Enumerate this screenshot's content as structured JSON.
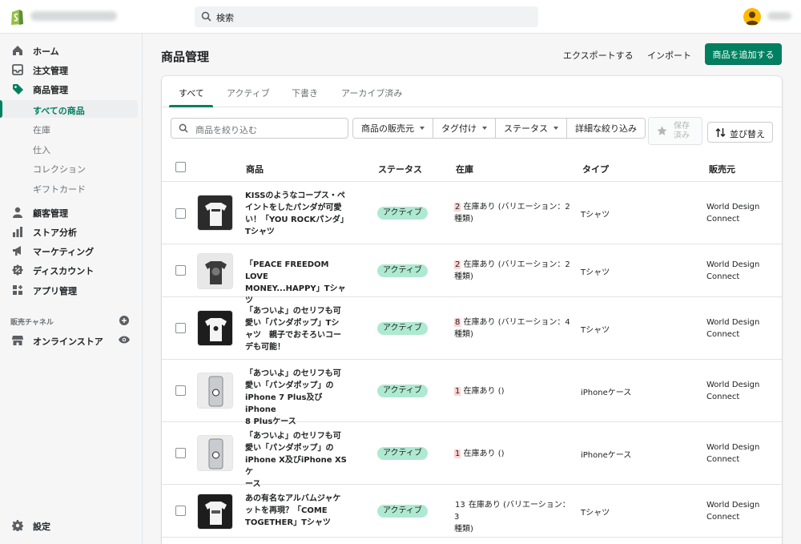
{
  "search": {
    "placeholder": "検索"
  },
  "sidebar": {
    "items": [
      {
        "label": "ホーム",
        "icon": "home-icon"
      },
      {
        "label": "注文管理",
        "icon": "orders-icon"
      },
      {
        "label": "商品管理",
        "icon": "tag-icon"
      }
    ],
    "sub_items": [
      "すべての商品",
      "在庫",
      "仕入",
      "コレクション",
      "ギフトカード"
    ],
    "items2": [
      {
        "label": "顧客管理",
        "icon": "customer-icon"
      },
      {
        "label": "ストア分析",
        "icon": "analytics-icon"
      },
      {
        "label": "マーケティング",
        "icon": "marketing-icon"
      },
      {
        "label": "ディスカウント",
        "icon": "discount-icon"
      },
      {
        "label": "アプリ管理",
        "icon": "apps-icon"
      }
    ],
    "channels_heading": "販売チャネル",
    "online_store": "オンラインストア",
    "settings": "設定"
  },
  "header": {
    "title": "商品管理",
    "export": "エクスポートする",
    "import": "インポート",
    "add_product": "商品を追加する"
  },
  "tabs": [
    "すべて",
    "アクティブ",
    "下書き",
    "アーカイブ済み"
  ],
  "filters": {
    "placeholder": "商品を絞り込む",
    "vendor": "商品の販売元",
    "tagged": "タグ付け",
    "status": "ステータス",
    "more": "詳細な絞り込み",
    "save_line1": "保存",
    "save_line2": "済み",
    "sort": "並び替え"
  },
  "table": {
    "headers": {
      "product": "商品",
      "status": "ステータス",
      "inventory": "在庫",
      "type": "タイプ",
      "vendor": "販売元"
    },
    "rows": [
      {
        "name_l1": "KISSのようなコープス・ペ",
        "name_l2": "イントをしたパンダが可愛",
        "name_l3": "い！「YOU ROCKパンダ」",
        "name_l4": "Tシャツ",
        "status": "アクティブ",
        "stock_num": "2",
        "stock_l1": " 在庫あり (バリエーション：2",
        "stock_l2": "種類)",
        "type": "Tシャツ",
        "vendor_l1": "World Design",
        "vendor_l2": "Connect"
      },
      {
        "name_l1": "「PEACE FREEDOM LOVE",
        "name_l2": "MONEY...HAPPY」Tシャツ",
        "status": "アクティブ",
        "stock_num": "2",
        "stock_l1": " 在庫あり (バリエーション：2",
        "stock_l2": "種類)",
        "type": "Tシャツ",
        "vendor_l1": "World Design",
        "vendor_l2": "Connect"
      },
      {
        "name_l1": "「あついよ」のセリフも可",
        "name_l2": "愛い「パンダポップ」Tシ",
        "name_l3": "ャツ　親子でおそろいコー",
        "name_l4": "デも可能！",
        "status": "アクティブ",
        "stock_num": "8",
        "stock_l1": " 在庫あり (バリエーション：4",
        "stock_l2": "種類)",
        "type": "Tシャツ",
        "vendor_l1": "World Design",
        "vendor_l2": "Connect"
      },
      {
        "name_l1": "「あついよ」のセリフも可",
        "name_l2": "愛い「パンダポップ」の",
        "name_l3": "iPhone 7 Plus及び iPhone",
        "name_l4": "8 Plusケース",
        "status": "アクティブ",
        "stock_num": "1",
        "stock_l1": " 在庫あり ()",
        "type": "iPhoneケース",
        "vendor_l1": "World Design",
        "vendor_l2": "Connect"
      },
      {
        "name_l1": "「あついよ」のセリフも可",
        "name_l2": "愛い「パンダポップ」の",
        "name_l3": "iPhone X及びiPhone XS ケ",
        "name_l4": "ース",
        "status": "アクティブ",
        "stock_num": "1",
        "stock_l1": " 在庫あり ()",
        "type": "iPhoneケース",
        "vendor_l1": "World Design",
        "vendor_l2": "Connect"
      },
      {
        "name_l1": "あの有名なアルバムジャケ",
        "name_l2": "ットを再現？「COME",
        "name_l3": "TOGETHER」Tシャツ",
        "status": "アクティブ",
        "stock_num": "13",
        "stock_l1": " 在庫あり (バリエーション：3",
        "stock_l2": "種類)",
        "type": "Tシャツ",
        "vendor_l1": "World Design",
        "vendor_l2": "Connect"
      }
    ]
  },
  "colors": {
    "accent": "#008060",
    "badge": "#aee9d1",
    "stock_highlight": "#fed3d1"
  }
}
